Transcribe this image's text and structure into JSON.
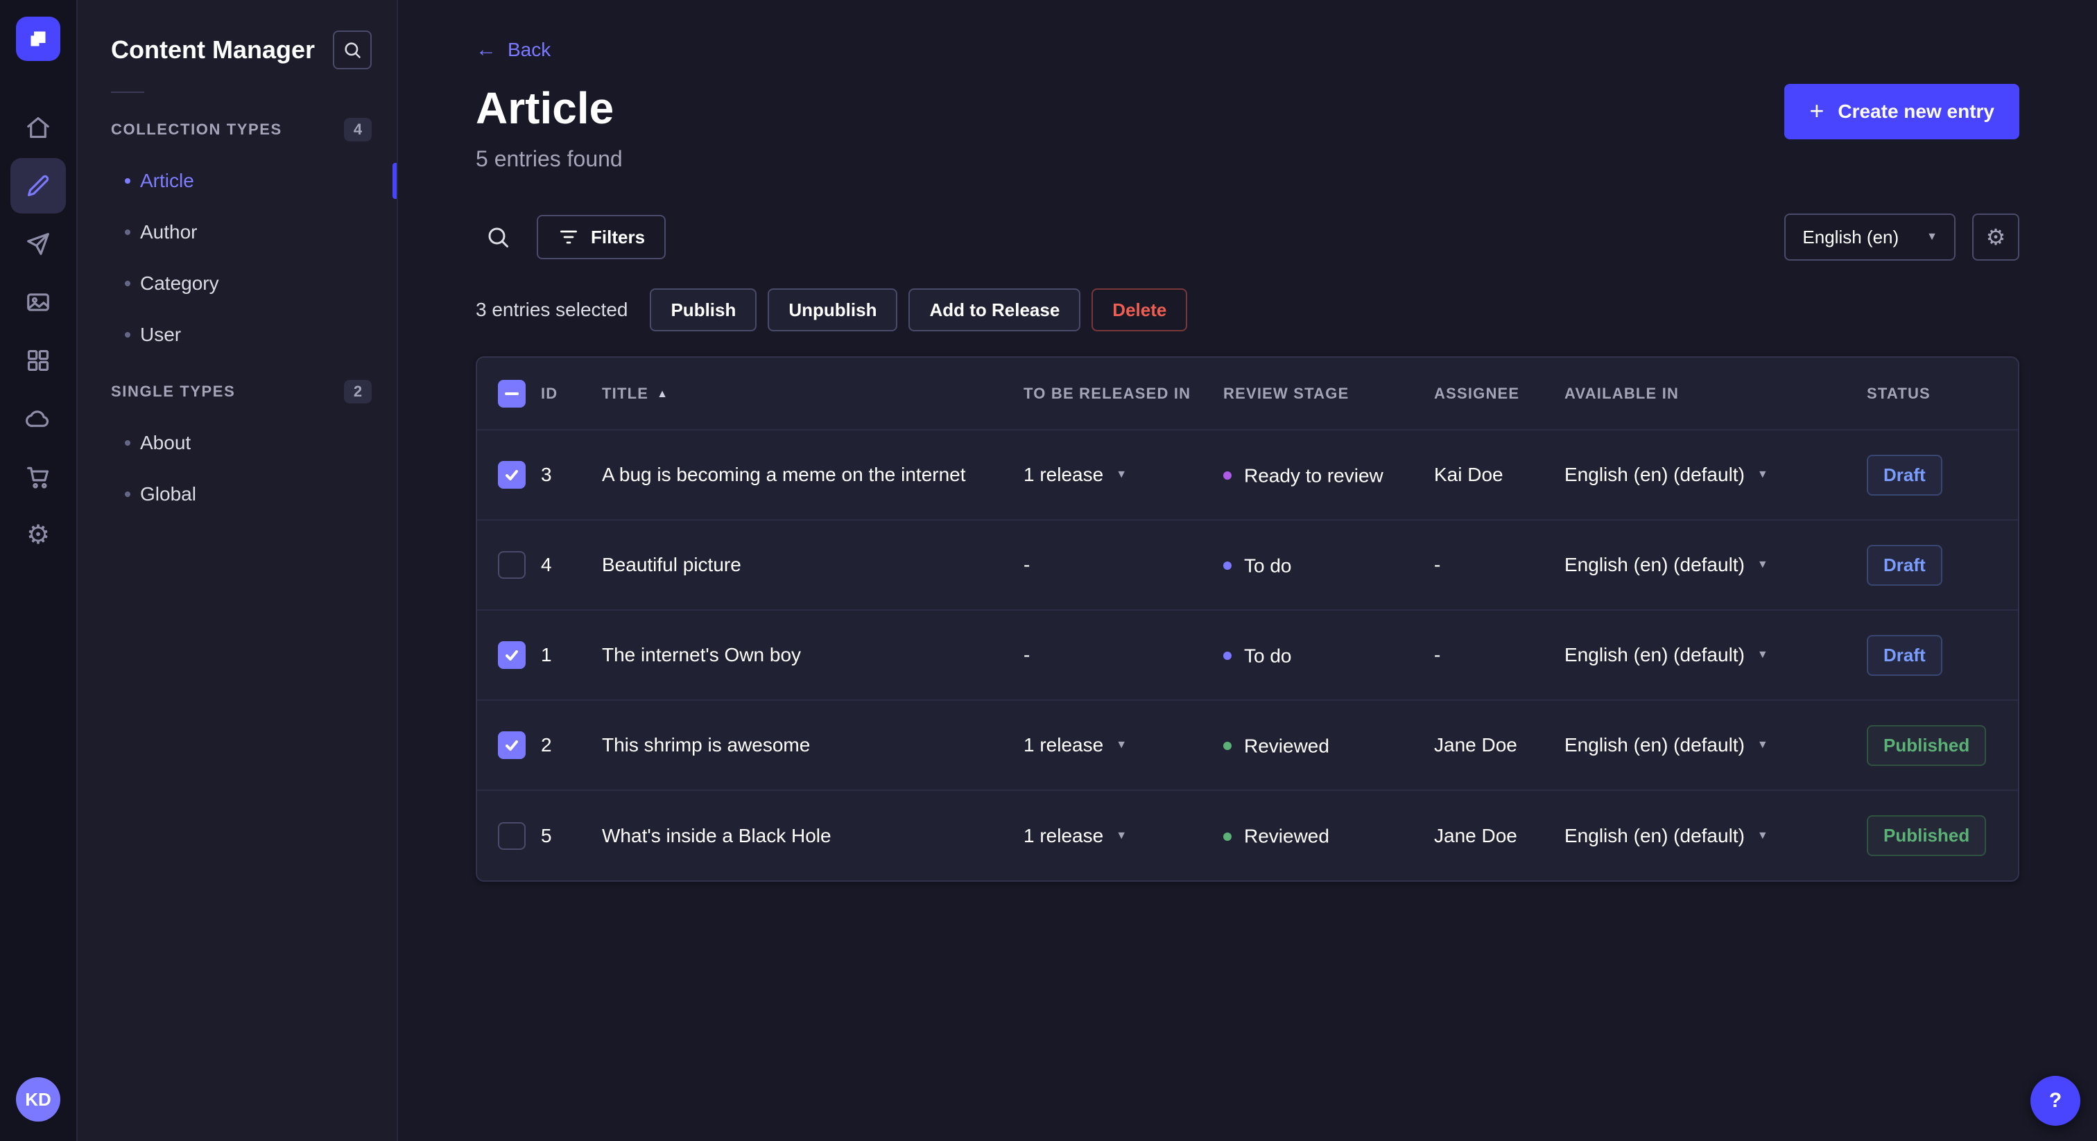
{
  "rail": {
    "logo_name": "strapi-logo",
    "items": [
      {
        "name": "home",
        "active": false
      },
      {
        "name": "content-manager",
        "active": true
      },
      {
        "name": "releases",
        "active": false
      },
      {
        "name": "media-library",
        "active": false
      },
      {
        "name": "content-type-builder",
        "active": false
      },
      {
        "name": "deploy",
        "active": false
      },
      {
        "name": "marketplace",
        "active": false
      },
      {
        "name": "settings",
        "active": false
      }
    ],
    "avatar_initials": "KD"
  },
  "sidebar": {
    "title": "Content Manager",
    "sections": [
      {
        "label": "COLLECTION TYPES",
        "badge": "4",
        "items": [
          {
            "label": "Article",
            "active": true
          },
          {
            "label": "Author",
            "active": false
          },
          {
            "label": "Category",
            "active": false
          },
          {
            "label": "User",
            "active": false
          }
        ]
      },
      {
        "label": "SINGLE TYPES",
        "badge": "2",
        "items": [
          {
            "label": "About",
            "active": false
          },
          {
            "label": "Global",
            "active": false
          }
        ]
      }
    ]
  },
  "header": {
    "back_label": "Back",
    "title": "Article",
    "subtitle": "5 entries found",
    "create_label": "Create new entry"
  },
  "toolbar": {
    "filters_label": "Filters",
    "locale_value": "English (en)"
  },
  "selection": {
    "count_text": "3 entries selected",
    "publish_label": "Publish",
    "unpublish_label": "Unpublish",
    "release_label": "Add to Release",
    "delete_label": "Delete"
  },
  "table": {
    "headers": {
      "id": "ID",
      "title": "TITLE",
      "release": "TO BE RELEASED IN",
      "stage": "REVIEW STAGE",
      "assignee": "ASSIGNEE",
      "available": "AVAILABLE IN",
      "status": "STATUS"
    },
    "rows": [
      {
        "checked": true,
        "id": "3",
        "title": "A bug is becoming a meme on the internet",
        "release": "1 release",
        "release_caret": true,
        "stage": "Ready to review",
        "stage_color": "#ac5ce8",
        "assignee": "Kai Doe",
        "available": "English (en) (default)",
        "status": "Draft"
      },
      {
        "checked": false,
        "id": "4",
        "title": "Beautiful picture",
        "release": "-",
        "release_caret": false,
        "stage": "To do",
        "stage_color": "#7b79ff",
        "assignee": "-",
        "available": "English (en) (default)",
        "status": "Draft"
      },
      {
        "checked": true,
        "id": "1",
        "title": "The internet's Own boy",
        "release": "-",
        "release_caret": false,
        "stage": "To do",
        "stage_color": "#7b79ff",
        "assignee": "-",
        "available": "English (en) (default)",
        "status": "Draft"
      },
      {
        "checked": true,
        "id": "2",
        "title": "This shrimp is awesome",
        "release": "1 release",
        "release_caret": true,
        "stage": "Reviewed",
        "stage_color": "#5cb176",
        "assignee": "Jane Doe",
        "available": "English (en) (default)",
        "status": "Published"
      },
      {
        "checked": false,
        "id": "5",
        "title": "What's inside a Black Hole",
        "release": "1 release",
        "release_caret": true,
        "stage": "Reviewed",
        "stage_color": "#5cb176",
        "assignee": "Jane Doe",
        "available": "English (en) (default)",
        "status": "Published"
      }
    ]
  },
  "colors": {
    "primary": "#4945ff",
    "primary_light": "#7b79ff",
    "draft": "#7b9dff",
    "published": "#5cb176",
    "danger": "#ee5e52",
    "stage_ready": "#ac5ce8",
    "stage_todo": "#7b79ff",
    "stage_reviewed": "#5cb176"
  },
  "help": {
    "label": "?"
  }
}
